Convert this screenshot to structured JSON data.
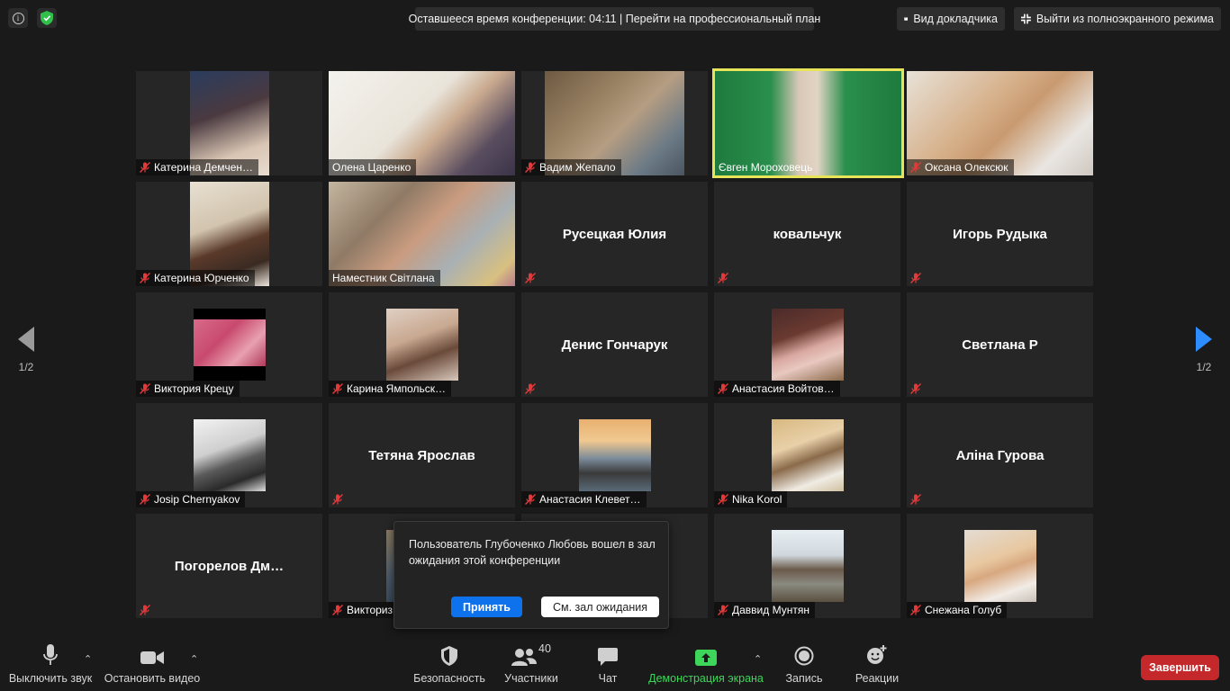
{
  "top_bar": {
    "timer_text": "Оставшееся время конференции: 04:11 | Перейти на профессиональный план",
    "speaker_view_label": "Вид докладчика",
    "exit_fullscreen_label": "Выйти из полноэкранного режима",
    "shield_color": "#2fbf4a"
  },
  "participants": [
    {
      "name": "Катерина Демчен…",
      "video": true,
      "muted": true
    },
    {
      "name": "Олена Царенко",
      "video": true,
      "muted": false
    },
    {
      "name": "Вадим Жепало",
      "video": true,
      "muted": true
    },
    {
      "name": "Євген Мороховець",
      "video": true,
      "muted": false,
      "active_speaker": true
    },
    {
      "name": "Оксана Олексюк",
      "video": true,
      "muted": true
    },
    {
      "name": "Катерина Юрченко",
      "video": true,
      "muted": true
    },
    {
      "name": "Наместник Світлана",
      "video": true,
      "muted": false
    },
    {
      "name": "Русецкая Юлия",
      "video": false,
      "muted": true
    },
    {
      "name": "ковальчук",
      "video": false,
      "muted": true
    },
    {
      "name": "Игорь Рудыка",
      "video": false,
      "muted": true
    },
    {
      "name": "Виктория Крецу",
      "video": true,
      "muted": true
    },
    {
      "name": "Карина Ямпольск…",
      "video": true,
      "muted": true
    },
    {
      "name": "Денис Гончарук",
      "video": false,
      "muted": true
    },
    {
      "name": "Анастасия Войтов…",
      "video": true,
      "muted": true
    },
    {
      "name": "Светлана Р",
      "video": false,
      "muted": true
    },
    {
      "name": "Josip Chernyakov",
      "video": true,
      "muted": true
    },
    {
      "name": "Тетяна Ярослав",
      "video": false,
      "muted": true
    },
    {
      "name": "Анастасия Клевет…",
      "video": true,
      "muted": true
    },
    {
      "name": "Nika Korol",
      "video": true,
      "muted": true
    },
    {
      "name": "Аліна Гурова",
      "video": false,
      "muted": true
    },
    {
      "name": "Погорелов  Дм…",
      "video": false,
      "muted": true
    },
    {
      "name": "Викториз",
      "video": true,
      "muted": true
    },
    {
      "name": "",
      "video": false,
      "muted": false
    },
    {
      "name": "Даввид Мунтян",
      "video": true,
      "muted": true
    },
    {
      "name": "Снежана Голуб",
      "video": true,
      "muted": true
    }
  ],
  "navigation": {
    "page_left": "1/2",
    "page_right": "1/2"
  },
  "notification": {
    "message": "Пользователь Глубоченко Любовь вошел в зал ожидания этой конференции",
    "accept_label": "Принять",
    "waiting_room_label": "См. зал ожидания"
  },
  "toolbar": {
    "mute_label": "Выключить звук",
    "video_label": "Остановить видео",
    "security_label": "Безопасность",
    "participants_label": "Участники",
    "participants_count": "40",
    "chat_label": "Чат",
    "share_label": "Демонстрация экрана",
    "record_label": "Запись",
    "reactions_label": "Реакции",
    "end_label": "Завершить"
  },
  "colors": {
    "accent_blue": "#0e72ed",
    "end_red": "#c4282a",
    "share_green": "#3dd65a",
    "active_speaker_border": "#e8e45a",
    "muted_red": "#e03a3a"
  }
}
